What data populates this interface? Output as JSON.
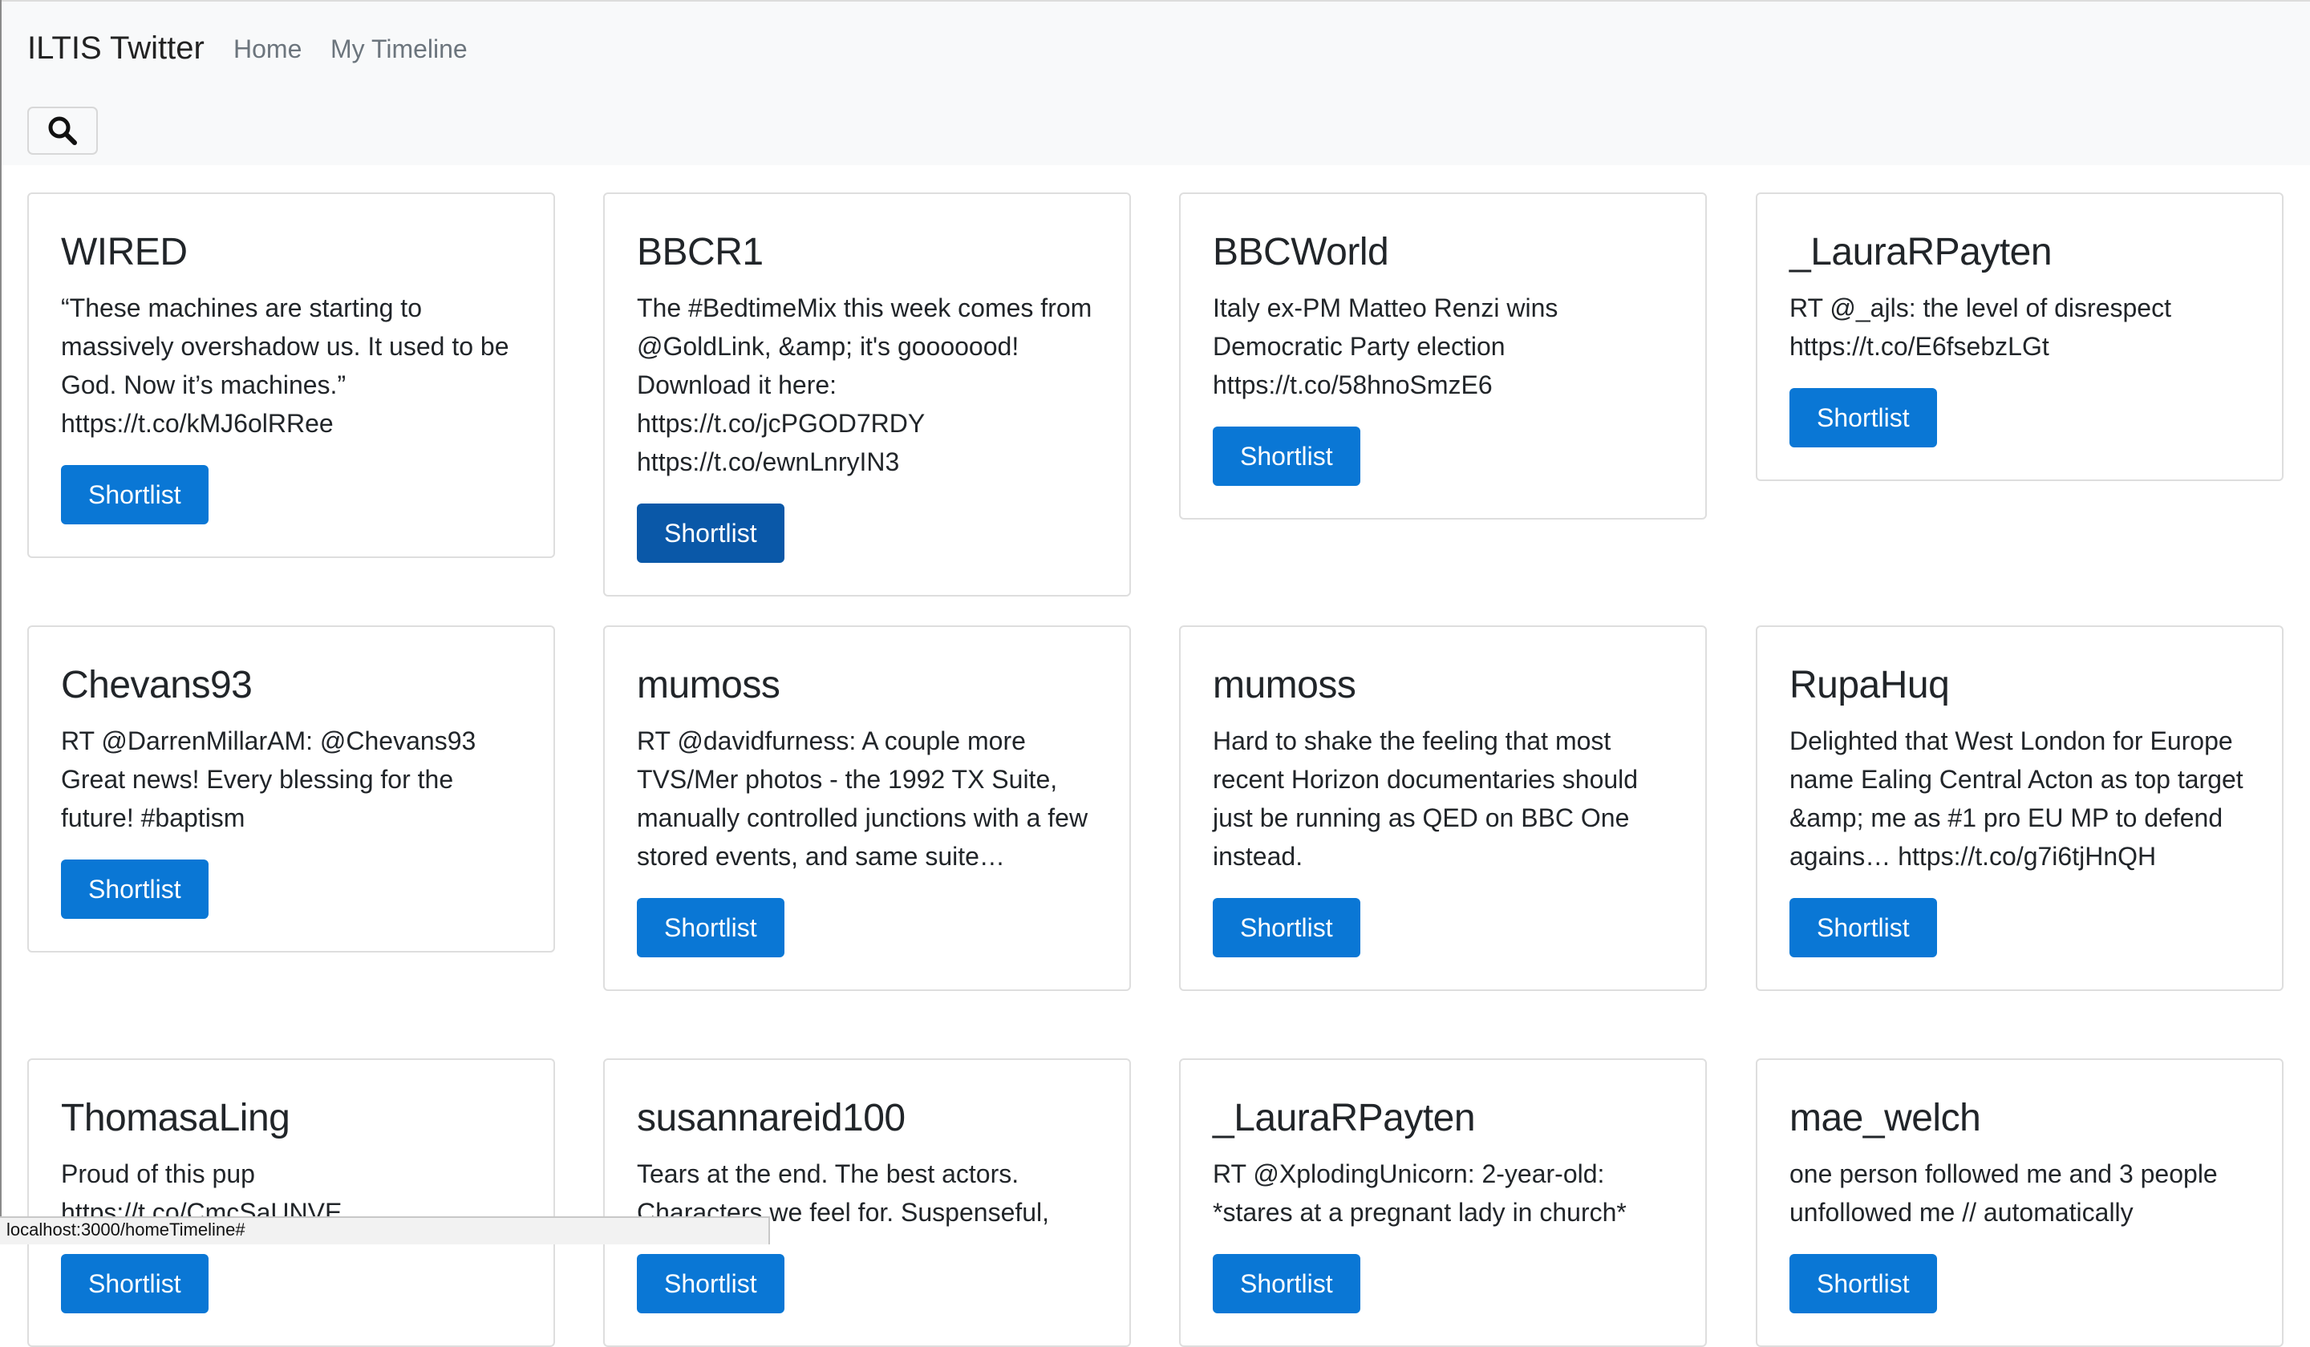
{
  "app": {
    "brand": "ILTIS Twitter",
    "nav": [
      {
        "label": "Home"
      },
      {
        "label": "My Timeline"
      }
    ],
    "search_icon": "search-icon"
  },
  "button_label": "Shortlist",
  "cards": [
    {
      "title": "WIRED",
      "text": "“These machines are starting to massively overshadow us. It used to be God. Now it’s machines.” https://t.co/kMJ6olRRee",
      "button": "Shortlist"
    },
    {
      "title": "BBCR1",
      "text": "The #BedtimeMix this week comes from @GoldLink, &amp; it's gooooood! Download it here: https://t.co/jcPGOD7RDY https://t.co/ewnLnryIN3",
      "button": "Shortlist",
      "active": true
    },
    {
      "title": "BBCWorld",
      "text": "Italy ex-PM Matteo Renzi wins Democratic Party election https://t.co/58hnoSmzE6",
      "button": "Shortlist"
    },
    {
      "title": "_LauraRPayten",
      "text": "RT @_ajls: the level of disrespect https://t.co/E6fsebzLGt",
      "button": "Shortlist"
    },
    {
      "title": "Chevans93",
      "text": "RT @DarrenMillarAM: @Chevans93 Great news! Every blessing for the future! #baptism",
      "button": "Shortlist"
    },
    {
      "title": "mumoss",
      "text": "RT @davidfurness: A couple more TVS/Mer photos - the 1992 TX Suite, manually controlled junctions with a few stored events, and same suite…",
      "button": "Shortlist"
    },
    {
      "title": "mumoss",
      "text": "Hard to shake the feeling that most recent Horizon documentaries should just be running as QED on BBC One instead.",
      "button": "Shortlist"
    },
    {
      "title": "RupaHuq",
      "text": "Delighted that West London for Europe name Ealing Central Acton as top target &amp; me as #1 pro EU MP to defend agains… https://t.co/g7i6tjHnQH",
      "button": "Shortlist"
    },
    {
      "title": "ThomasaLing",
      "text": "Proud of this pup https://t.co/CmcSaUNVE",
      "button": "Shortlist"
    },
    {
      "title": "susannareid100",
      "text": "Tears at the end. The best actors. Characters we feel for. Suspenseful,",
      "button": "Shortlist"
    },
    {
      "title": "_LauraRPayten",
      "text": "RT @XplodingUnicorn: 2-year-old: *stares at a pregnant lady in church*",
      "button": "Shortlist"
    },
    {
      "title": "mae_welch",
      "text": "one person followed me and 3 people unfollowed me // automatically",
      "button": "Shortlist"
    }
  ],
  "status_url": "localhost:3000/homeTimeline#"
}
